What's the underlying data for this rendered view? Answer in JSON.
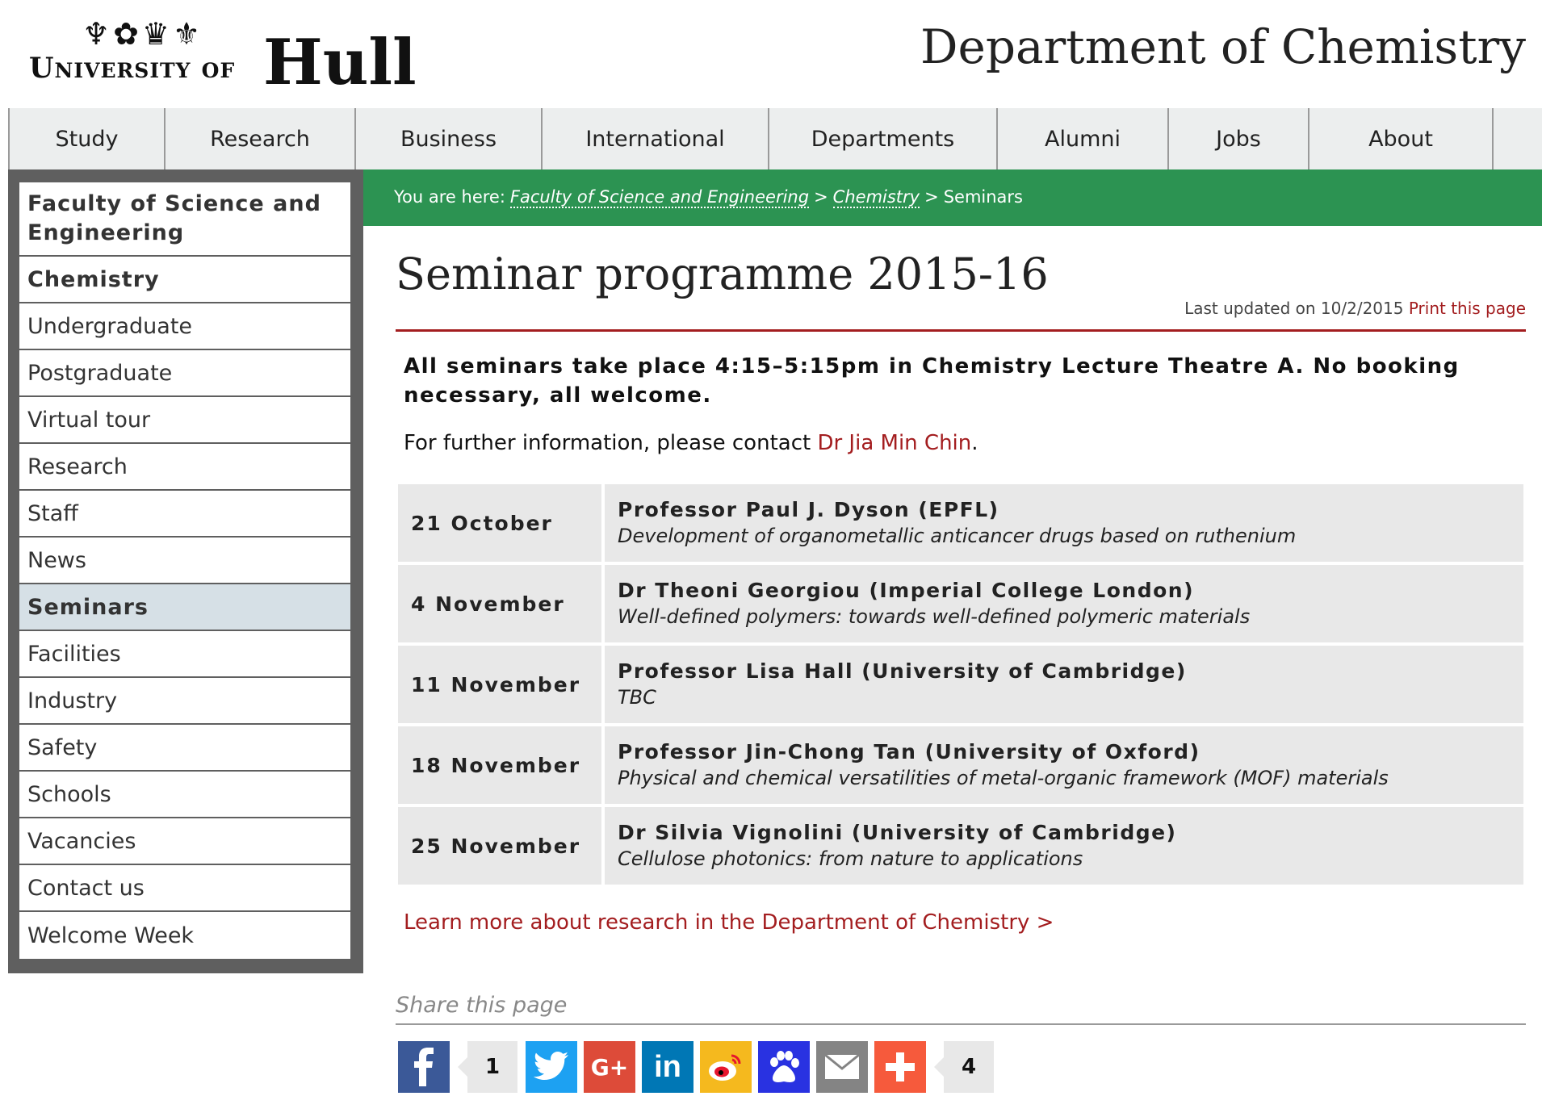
{
  "header": {
    "logo_icons": "♆✿♛⚜",
    "logo_univ": "University of",
    "logo_hull": "Hull",
    "dept_title": "Department of Chemistry"
  },
  "topnav": [
    "Study",
    "Research",
    "Business",
    "International",
    "Departments",
    "Alumni",
    "Jobs",
    "About"
  ],
  "sidebar": {
    "items": [
      "Faculty of Science and Engineering",
      "Chemistry",
      "Undergraduate",
      "Postgraduate",
      "Virtual tour",
      "Research",
      "Staff",
      "News",
      "Seminars",
      "Facilities",
      "Industry",
      "Safety",
      "Schools",
      "Vacancies",
      "Contact us",
      "Welcome Week"
    ],
    "active": "Seminars"
  },
  "breadcrumb": {
    "prefix": "You are here:",
    "links": [
      "Faculty of Science and Engineering",
      "Chemistry"
    ],
    "separator": ">",
    "current": "Seminars"
  },
  "main": {
    "title": "Seminar programme 2015-16",
    "updated_text": "Last updated on 10/2/2015",
    "print_link": "Print this page",
    "intro_bold": "All seminars take place 4:15–5:15pm in Chemistry Lecture Theatre A. No booking necessary, all welcome.",
    "contact_text": "For further information, please contact",
    "contact_link": "Dr Jia Min Chin",
    "contact_end": ".",
    "seminars": [
      {
        "date": "21 October",
        "speaker": "Professor Paul J. Dyson (EPFL)",
        "talk": "Development of organometallic anticancer drugs based on ruthenium"
      },
      {
        "date": "4 November",
        "speaker": "Dr Theoni Georgiou (Imperial College London)",
        "talk": "Well-defined polymers: towards well-defined polymeric materials"
      },
      {
        "date": "11 November",
        "speaker": "Professor Lisa Hall (University of Cambridge)",
        "talk": "TBC"
      },
      {
        "date": "18 November",
        "speaker": "Professor Jin-Chong Tan (University of Oxford)",
        "talk": "Physical and chemical versatilities of metal-organic framework (MOF) materials"
      },
      {
        "date": "25 November",
        "speaker": "Dr Silvia Vignolini (University of Cambridge)",
        "talk": "Cellulose photonics: from nature to applications"
      }
    ],
    "learn_more": "Learn more about research in the Department of Chemistry >"
  },
  "share": {
    "label": "Share this page",
    "facebook_count": "1",
    "total_count": "4",
    "buttons": [
      {
        "name": "facebook",
        "icon": "facebook-icon",
        "color": "#3b5998"
      },
      {
        "name": "twitter",
        "icon": "twitter-icon",
        "color": "#1da1f2"
      },
      {
        "name": "google-plus",
        "icon": "google-plus-icon",
        "color": "#dd4b39"
      },
      {
        "name": "linkedin",
        "icon": "linkedin-icon",
        "color": "#0077b5"
      },
      {
        "name": "weibo",
        "icon": "weibo-icon",
        "color": "#f5b91e"
      },
      {
        "name": "baidu",
        "icon": "baidu-icon",
        "color": "#2932e1"
      },
      {
        "name": "email",
        "icon": "email-icon",
        "color": "#848484"
      },
      {
        "name": "more",
        "icon": "plus-icon",
        "color": "#f65a3c"
      }
    ]
  },
  "colors": {
    "green_bar": "#2c9352",
    "accent_red": "#a31d1f",
    "sidebar_bg": "#5f5f5f",
    "active_item": "#d6e0e6"
  }
}
